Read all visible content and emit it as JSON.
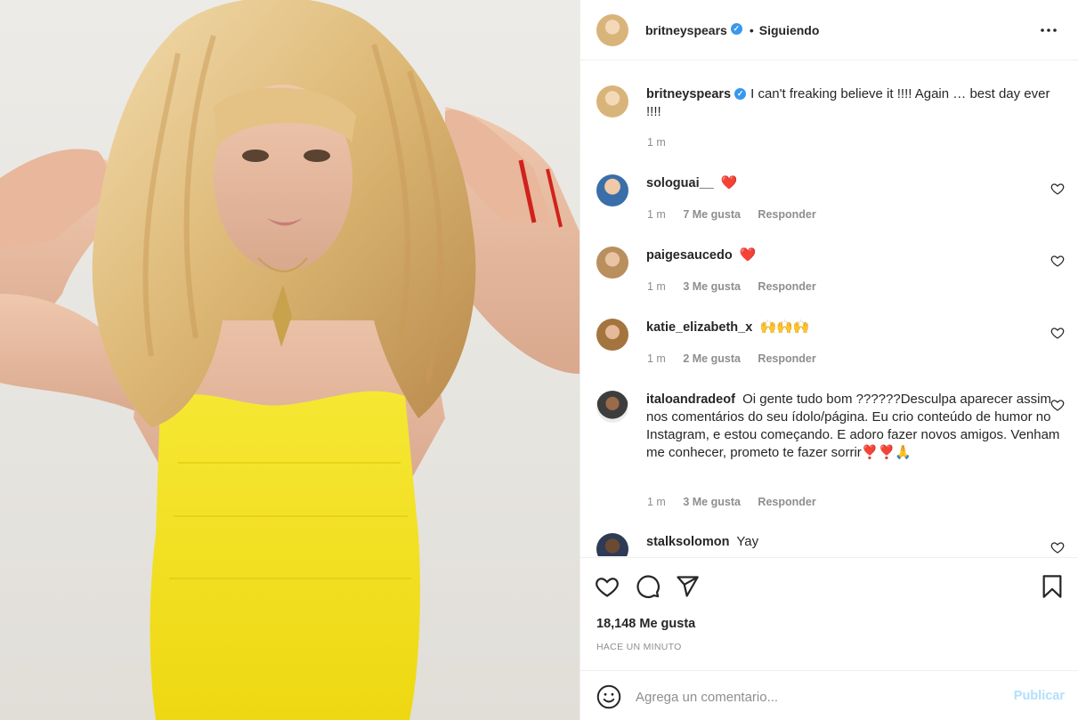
{
  "post": {
    "author": "britneyspears",
    "follow_state": "Siguiendo",
    "header_separator": "•",
    "verified_glyph": "✓",
    "caption": "I can't freaking believe it !!!! Again … best day ever !!!!",
    "caption_time": "1 m"
  },
  "comments": [
    {
      "user": "sologuai__",
      "text": "❤️",
      "time": "1 m",
      "likes": "7 Me gusta",
      "reply": "Responder",
      "avatar_icon": "person-avatar-icon"
    },
    {
      "user": "paigesaucedo",
      "text": "❤️",
      "time": "1 m",
      "likes": "3 Me gusta",
      "reply": "Responder",
      "avatar_icon": "person-avatar-icon"
    },
    {
      "user": "katie_elizabeth_x",
      "text": "🙌🙌🙌",
      "time": "1 m",
      "likes": "2 Me gusta",
      "reply": "Responder",
      "avatar_icon": "person-avatar-icon"
    },
    {
      "user": "italoandradeof",
      "text": "Oi gente tudo bom ??????Desculpa aparecer assim nos comentários do seu ídolo/página. Eu crio conteúdo de humor no Instagram, e estou começando. E adoro fazer novos amigos. Venham me conhecer, prometo te fazer sorrir❣️❣️🙏",
      "time": "1 m",
      "likes": "3 Me gusta",
      "reply": "Responder",
      "avatar_icon": "person-avatar-icon"
    },
    {
      "user": "stalksolomon",
      "text": "Yay",
      "time": "",
      "likes": "",
      "reply": "",
      "avatar_icon": "person-avatar-icon"
    }
  ],
  "actions": {
    "like_icon": "heart-outline-icon",
    "comment_icon": "comment-bubble-icon",
    "share_icon": "paper-plane-icon",
    "save_icon": "bookmark-icon",
    "likes_count": "18,148 Me gusta",
    "time_ago": "HACE UN MINUTO"
  },
  "composer": {
    "placeholder": "Agrega un comentario...",
    "publish_label": "Publicar",
    "emoji_icon": "smiley-icon"
  },
  "colors": {
    "accent_blue": "#3897f0",
    "publish_disabled": "#b2dffc",
    "muted_text": "#8e8e8e",
    "heart_red": "#ed4956",
    "dress_yellow": "#f2e21d"
  }
}
